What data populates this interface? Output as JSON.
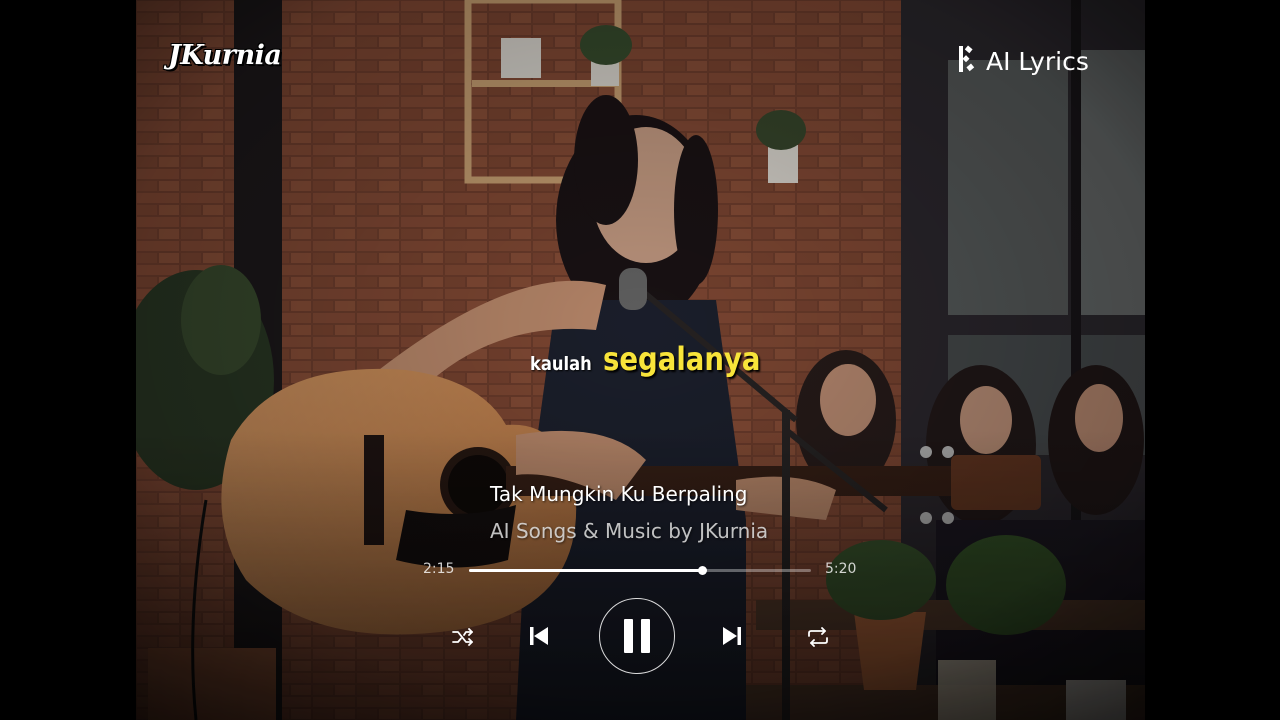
{
  "brand": {
    "label": "JKurnia"
  },
  "badge": {
    "icon": "ai-sparkle-icon",
    "label": "AI Lyrics"
  },
  "lyrics": {
    "previous_word": "kaulah",
    "current_word": "segalanya"
  },
  "song": {
    "title": "Tak Mungkin Ku Berpaling",
    "artist": "AI Songs & Music by JKurnia"
  },
  "player": {
    "elapsed": "2:15",
    "total": "5:20",
    "progress": 0.68,
    "state": "playing",
    "controls": {
      "shuffle": "shuffle-icon",
      "previous": "skip-previous-icon",
      "play_pause": "pause-icon",
      "next": "skip-next-icon",
      "repeat": "repeat-icon"
    }
  },
  "colors": {
    "lyric_highlight": "#f8e43a",
    "text_primary": "#ffffff",
    "text_secondary": "#e1e1e1"
  }
}
